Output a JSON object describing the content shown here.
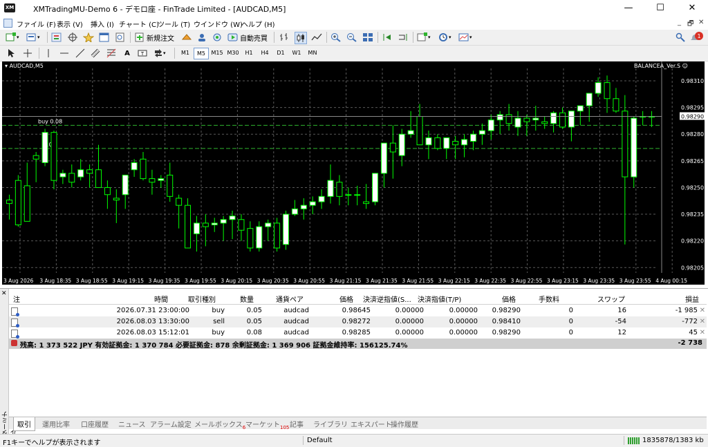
{
  "window": {
    "title": "XMTradingMU-Demo 6 - デモロ座 - FinTrade Limited - [AUDCAD,M5]",
    "min": "—",
    "max": "☐",
    "close": "✕"
  },
  "menu": {
    "items": [
      "ファイル (F)",
      "表示 (V)",
      "挿入 (I)",
      "チャート (C)",
      "ツール (T)",
      "ウインドウ (W)",
      "ヘルプ (H)"
    ],
    "mdi": [
      "_",
      "🗗",
      "✕"
    ]
  },
  "toolbar": {
    "new_order": "新規注文",
    "autotrade": "自動売買",
    "text_tool": "A",
    "notification_count": "1"
  },
  "timeframes": [
    "M1",
    "M5",
    "M15",
    "M30",
    "H1",
    "H4",
    "D1",
    "W1",
    "MN"
  ],
  "chart": {
    "title": "AUDCAD,M5",
    "ea": "BALANCEA_Ver.S ☺",
    "current_price": "0.98290",
    "buy_label": "buy 0.08",
    "second_label": "0.05",
    "y_ticks": [
      "0.98310",
      "0.98295",
      "0.98280",
      "0.98265",
      "0.98250",
      "0.98235",
      "0.98220",
      "0.98205"
    ],
    "x_ticks": [
      "3 Aug 2026",
      "3 Aug 18:35",
      "3 Aug 18:55",
      "3 Aug 19:15",
      "3 Aug 19:35",
      "3 Aug 19:55",
      "3 Aug 20:15",
      "3 Aug 20:35",
      "3 Aug 20:55",
      "3 Aug 21:15",
      "3 Aug 21:35",
      "3 Aug 21:55",
      "3 Aug 22:15",
      "3 Aug 22:35",
      "3 Aug 22:55",
      "3 Aug 23:15",
      "3 Aug 23:35",
      "3 Aug 23:55",
      "4 Aug 00:15"
    ],
    "candles": [
      [
        0.98243,
        0.98246,
        0.98232,
        0.98241
      ],
      [
        0.98254,
        0.98257,
        0.98228,
        0.98229
      ],
      [
        0.98251,
        0.98264,
        0.9824,
        0.98231
      ],
      [
        0.98268,
        0.9827,
        0.98253,
        0.98266
      ],
      [
        0.98264,
        0.98283,
        0.98262,
        0.98281
      ],
      [
        0.98281,
        0.98282,
        0.98249,
        0.98254
      ],
      [
        0.98256,
        0.9826,
        0.98252,
        0.98258
      ],
      [
        0.98258,
        0.98263,
        0.9825,
        0.98253
      ],
      [
        0.98256,
        0.98266,
        0.98254,
        0.9826
      ],
      [
        0.9826,
        0.98263,
        0.9825,
        0.98258
      ],
      [
        0.9826,
        0.98274,
        0.98251,
        0.9825
      ],
      [
        0.9825,
        0.98254,
        0.98238,
        0.98246
      ],
      [
        0.98244,
        0.98249,
        0.9823,
        0.98243
      ],
      [
        0.98246,
        0.98253,
        0.98238,
        0.98257
      ],
      [
        0.9826,
        0.98266,
        0.98256,
        0.98264
      ],
      [
        0.98266,
        0.9827,
        0.98254,
        0.98255
      ],
      [
        0.98255,
        0.9826,
        0.98246,
        0.98253
      ],
      [
        0.98254,
        0.98257,
        0.9825,
        0.98255
      ],
      [
        0.98257,
        0.98264,
        0.98242,
        0.98245
      ],
      [
        0.98244,
        0.98246,
        0.98227,
        0.9824
      ],
      [
        0.9824,
        0.98244,
        0.9822,
        0.98216
      ],
      [
        0.98224,
        0.98234,
        0.98214,
        0.9823
      ],
      [
        0.9823,
        0.98235,
        0.98217,
        0.98228
      ],
      [
        0.98229,
        0.98233,
        0.98225,
        0.9823
      ],
      [
        0.9823,
        0.98234,
        0.9822,
        0.98232
      ],
      [
        0.98232,
        0.98237,
        0.98221,
        0.98234
      ],
      [
        0.98232,
        0.98235,
        0.9822,
        0.98226
      ],
      [
        0.98227,
        0.98231,
        0.98214,
        0.98216
      ],
      [
        0.98216,
        0.98231,
        0.98214,
        0.98228
      ],
      [
        0.98228,
        0.98232,
        0.9822,
        0.9823
      ],
      [
        0.9823,
        0.98233,
        0.98214,
        0.98216
      ],
      [
        0.98218,
        0.98237,
        0.98215,
        0.98235
      ],
      [
        0.98235,
        0.98243,
        0.98234,
        0.98238
      ],
      [
        0.98238,
        0.98244,
        0.98232,
        0.9824
      ],
      [
        0.9824,
        0.98245,
        0.98235,
        0.98242
      ],
      [
        0.98242,
        0.98249,
        0.98238,
        0.98245
      ],
      [
        0.98245,
        0.98263,
        0.98241,
        0.98254
      ],
      [
        0.98253,
        0.98257,
        0.9824,
        0.98245
      ],
      [
        0.98246,
        0.9825,
        0.9824,
        0.98246
      ],
      [
        0.98246,
        0.98251,
        0.9824,
        0.98246
      ],
      [
        0.98242,
        0.98252,
        0.98238,
        0.98241
      ],
      [
        0.98242,
        0.98258,
        0.9824,
        0.98258
      ],
      [
        0.98258,
        0.9827,
        0.9825,
        0.98275
      ],
      [
        0.98275,
        0.98285,
        0.98255,
        0.9827
      ],
      [
        0.98268,
        0.98283,
        0.98262,
        0.9828
      ],
      [
        0.9828,
        0.98293,
        0.98278,
        0.98282
      ],
      [
        0.9829,
        0.98297,
        0.98275,
        0.98274
      ],
      [
        0.98274,
        0.98282,
        0.98266,
        0.98278
      ],
      [
        0.98278,
        0.9828,
        0.98271,
        0.98272
      ],
      [
        0.98272,
        0.98277,
        0.98266,
        0.98278
      ],
      [
        0.98276,
        0.98279,
        0.98266,
        0.98274
      ],
      [
        0.98274,
        0.9828,
        0.98267,
        0.98277
      ],
      [
        0.98276,
        0.98282,
        0.98271,
        0.9828
      ],
      [
        0.9828,
        0.98286,
        0.98274,
        0.98282
      ],
      [
        0.98282,
        0.98291,
        0.98277,
        0.98288
      ],
      [
        0.98288,
        0.98293,
        0.9828,
        0.98291
      ],
      [
        0.98291,
        0.98297,
        0.98282,
        0.98286
      ],
      [
        0.98284,
        0.98293,
        0.98279,
        0.98289
      ],
      [
        0.98289,
        0.98291,
        0.98279,
        0.98287
      ],
      [
        0.98288,
        0.98296,
        0.98282,
        0.98289
      ],
      [
        0.98287,
        0.9829,
        0.98283,
        0.98286
      ],
      [
        0.98286,
        0.98293,
        0.98281,
        0.98292
      ],
      [
        0.98292,
        0.98295,
        0.98283,
        0.98284
      ],
      [
        0.98284,
        0.98291,
        0.98276,
        0.98293
      ],
      [
        0.98293,
        0.98294,
        0.98285,
        0.98296
      ],
      [
        0.98296,
        0.98299,
        0.98287,
        0.98303
      ],
      [
        0.98303,
        0.98312,
        0.98301,
        0.98309
      ],
      [
        0.98309,
        0.98313,
        0.98292,
        0.983
      ],
      [
        0.983,
        0.98306,
        0.98292,
        0.98293
      ],
      [
        0.98293,
        0.98302,
        0.98218,
        0.98256
      ],
      [
        0.98256,
        0.9829,
        0.9825,
        0.98289
      ],
      [
        0.9829,
        0.98293,
        0.98285,
        0.9829
      ],
      [
        0.9829,
        0.98293,
        0.98284,
        0.9829
      ]
    ],
    "ylim": [
      0.98202,
      0.98317
    ],
    "colors": {
      "bull": "#ffffff",
      "bear": "#000000",
      "wick": "#00ff00",
      "grid": "#5a5a5a",
      "text": "#ffffff"
    }
  },
  "terminal": {
    "side_label": "ターミナル",
    "columns": [
      "注",
      "時間",
      "取引種別",
      "数量",
      "通貨ペア",
      "価格",
      "決済逆指値(S...",
      "決済指値(T/P)",
      "価格",
      "手数料",
      "スワップ",
      "損益"
    ],
    "rows": [
      [
        "2026.07.31 23:00:00",
        "buy",
        "0.05",
        "audcad",
        "0.98645",
        "0.00000",
        "0.00000",
        "0.98290",
        "0",
        "16",
        "-1 985"
      ],
      [
        "2026.08.03 13:30:00",
        "sell",
        "0.05",
        "audcad",
        "0.98272",
        "0.00000",
        "0.00000",
        "0.98410",
        "0",
        "-54",
        "-772"
      ],
      [
        "2026.08.03 15:12:01",
        "buy",
        "0.08",
        "audcad",
        "0.98285",
        "0.00000",
        "0.00000",
        "0.98290",
        "0",
        "12",
        "45"
      ]
    ],
    "summary": "残高: 1 373 522 JPY  有効証拠金: 1 370 784  必要証拠金: 878  余剰証拠金: 1 369 906  証拠金維持率: 156125.74%",
    "summary_total": "-2 738",
    "tabs": [
      {
        "label": "取引",
        "badge": ""
      },
      {
        "label": "運用比率",
        "badge": ""
      },
      {
        "label": "口座履歴",
        "badge": ""
      },
      {
        "label": "ニュース",
        "badge": ""
      },
      {
        "label": "アラーム設定",
        "badge": ""
      },
      {
        "label": "メールボックス",
        "badge": "6"
      },
      {
        "label": "マーケット",
        "badge": "105"
      },
      {
        "label": "記事",
        "badge": ""
      },
      {
        "label": "ライブラリ",
        "badge": ""
      },
      {
        "label": "エキスパート",
        "badge": ""
      },
      {
        "label": "操作履歴",
        "badge": ""
      }
    ]
  },
  "status": {
    "help": "F1キーでヘルプが表示されます",
    "profile": "Default",
    "traffic": "1835878/1383 kb"
  }
}
